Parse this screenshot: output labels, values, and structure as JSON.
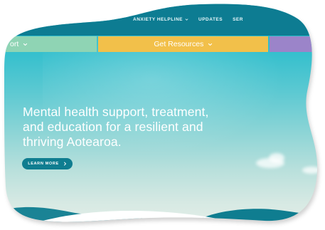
{
  "topnav": {
    "items": [
      {
        "label": "ANXIETY HELPLINE",
        "has_dropdown": true
      },
      {
        "label": "UPDATES",
        "has_dropdown": false
      },
      {
        "label": "SER",
        "has_dropdown": false
      }
    ]
  },
  "tabs": {
    "support_label": "ort",
    "resources_label": "Get Resources"
  },
  "hero": {
    "title_line1": "Mental health support, treatment,",
    "title_line2": "and education for a resilient and",
    "title_line3": "thriving Aotearoa.",
    "cta_label": "LEARN MORE"
  },
  "colors": {
    "topbar": "#0d7c92",
    "tab_support": "#8fd4b4",
    "tab_resources": "#f2c04a",
    "tab_purple": "#9b84c9",
    "cta": "#0f7d90",
    "hill": "#0f7d90"
  },
  "icons": {
    "topnav_dropdown": "chevron-down-icon",
    "tab_dropdown": "chevron-down-icon",
    "cta_arrow": "chevron-right-icon"
  }
}
